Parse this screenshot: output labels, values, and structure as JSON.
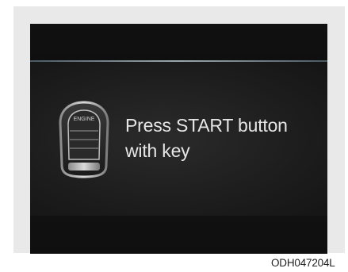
{
  "display": {
    "message_line1": "Press START button",
    "message_line2": "with key",
    "key_icon_label": "ENGINE"
  },
  "reference_code": "ODH047204L",
  "colors": {
    "display_background": "#141414",
    "divider": "#9aa7ae",
    "message_text": "#e6e6e6"
  },
  "icons": {
    "key": "smart-key-fob-icon"
  }
}
